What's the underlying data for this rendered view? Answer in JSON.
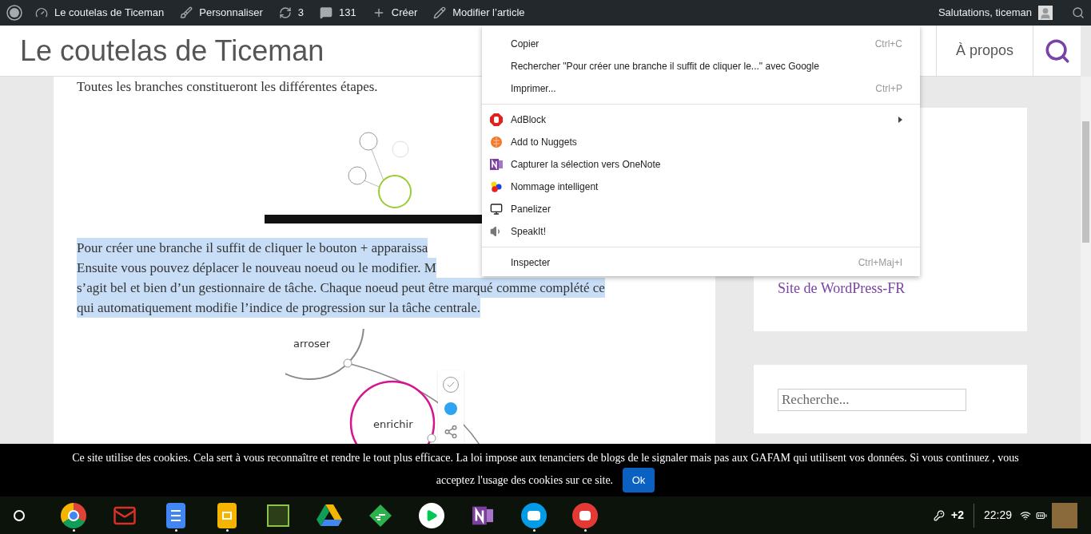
{
  "admin_bar": {
    "items": [
      {
        "kind": "dashboard",
        "label": "Le coutelas de Ticeman"
      },
      {
        "kind": "brush",
        "label": "Personnaliser"
      },
      {
        "kind": "refresh",
        "label": "3"
      },
      {
        "kind": "comment",
        "label": "131"
      },
      {
        "kind": "plus",
        "label": "Créer"
      },
      {
        "kind": "pencil",
        "label": "Modifier l’article"
      }
    ],
    "greeting": "Salutations, ticeman"
  },
  "header": {
    "site_title": "Le coutelas de Ticeman",
    "nav": [
      "À propos"
    ]
  },
  "article": {
    "intro": "Toutes les branches constitueront les différentes étapes.",
    "paragraph_selected": true,
    "paragraph_lines": [
      "Pour créer une branche il suffit de cliquer le bouton + apparaissa",
      "Ensuite vous pouvez déplacer le nouveau noeud ou le modifier. M",
      "s’agit bel et bien d’un gestionnaire de tâche. Chaque noeud peut être marqué comme complété ce",
      "qui automatiquement modifie l’indice de progression sur la tâche centrale."
    ],
    "mindmap_nodes": [
      "arroser",
      "enrichir"
    ]
  },
  "sidebar": {
    "link": "Site de WordPress-FR",
    "search": {
      "placeholder": "Recherche..."
    }
  },
  "context_menu": {
    "groups": [
      [
        {
          "kind": "plain",
          "label": "Copier",
          "shortcut": "Ctrl+C",
          "submenu": false
        },
        {
          "kind": "plain",
          "label": "Rechercher \"Pour créer une branche il suffit de cliquer le...\" avec Google",
          "submenu": false
        },
        {
          "kind": "plain",
          "label": "Imprimer...",
          "shortcut": "Ctrl+P",
          "submenu": false
        }
      ],
      [
        {
          "kind": "adblock",
          "label": "AdBlock",
          "submenu": true
        },
        {
          "kind": "nuggets",
          "label": "Add to Nuggets",
          "submenu": false
        },
        {
          "kind": "onenote",
          "label": "Capturer la sélection vers OneNote",
          "submenu": false
        },
        {
          "kind": "dots",
          "label": "Nommage intelligent",
          "submenu": false
        },
        {
          "kind": "monitor",
          "label": "Panelizer",
          "submenu": false
        },
        {
          "kind": "speaker",
          "label": "SpeakIt!",
          "submenu": false
        }
      ],
      [
        {
          "kind": "plain",
          "label": "Inspecter",
          "shortcut": "Ctrl+Maj+I",
          "submenu": false
        }
      ]
    ]
  },
  "cookie_banner": {
    "text": "Ce site utilise des cookies. Cela sert à vous reconnaître et rendre le tout plus efficace. La loi impose aux tenanciers de blogs de le signaler mais pas aux GAFAM qui utilisent vos données. Si vous continuez , vous acceptez l'usage des cookies sur ce site.",
    "button": "Ok"
  },
  "taskbar": {
    "apps": [
      {
        "kind": "chrome",
        "running": true
      },
      {
        "kind": "gmail",
        "running": false
      },
      {
        "kind": "docs",
        "running": true
      },
      {
        "kind": "slides",
        "running": true
      },
      {
        "kind": "green",
        "running": false
      },
      {
        "kind": "drive",
        "running": false
      },
      {
        "kind": "feedly",
        "running": false
      },
      {
        "kind": "play",
        "running": false
      },
      {
        "kind": "onenote",
        "running": false
      },
      {
        "kind": "files",
        "running": true
      },
      {
        "kind": "photos",
        "running": true
      }
    ],
    "notifications": "+2",
    "time": "22:29"
  }
}
